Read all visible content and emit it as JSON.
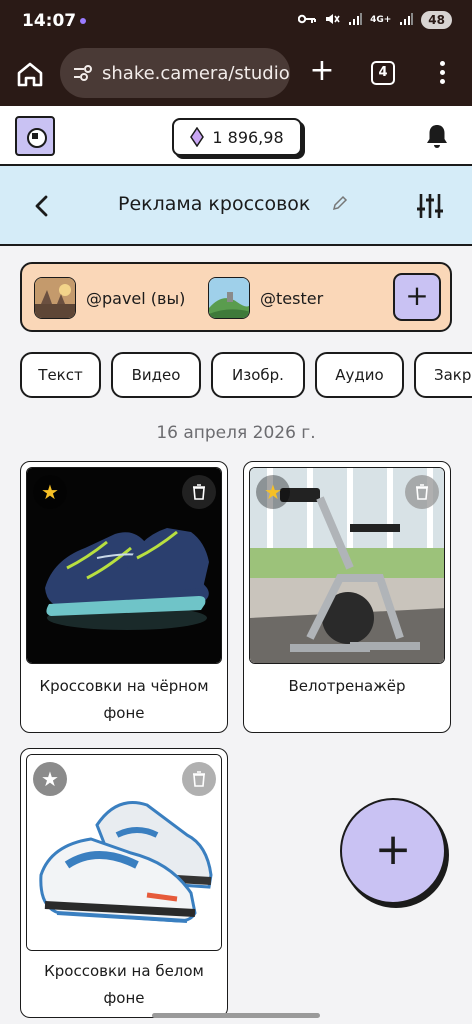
{
  "status_bar": {
    "time": "14:07",
    "network": "4G+",
    "battery": "48"
  },
  "browser": {
    "url": "shake.camera/studio",
    "tab_count": "4"
  },
  "header": {
    "balance": "1 896,98"
  },
  "project": {
    "title": "Реклама кроссовок"
  },
  "members": [
    {
      "handle": "@pavel (вы)"
    },
    {
      "handle": "@tester"
    }
  ],
  "filters": [
    "Текст",
    "Видео",
    "Изобр.",
    "Аудио",
    "Закр"
  ],
  "date_group": "16 апреля 2026 г.",
  "items": [
    {
      "caption": "Кроссовки на чёрном фоне",
      "favorite": true
    },
    {
      "caption": "Велотренажёр",
      "favorite": true
    },
    {
      "caption": "Кроссовки на белом фоне",
      "favorite": false
    }
  ],
  "colors": {
    "accent": "#c9c2f3",
    "members_bg": "#fad7b8",
    "project_bar_bg": "#d5ecf8",
    "star": "#f6c026",
    "browser_bg": "#2a1a16"
  }
}
